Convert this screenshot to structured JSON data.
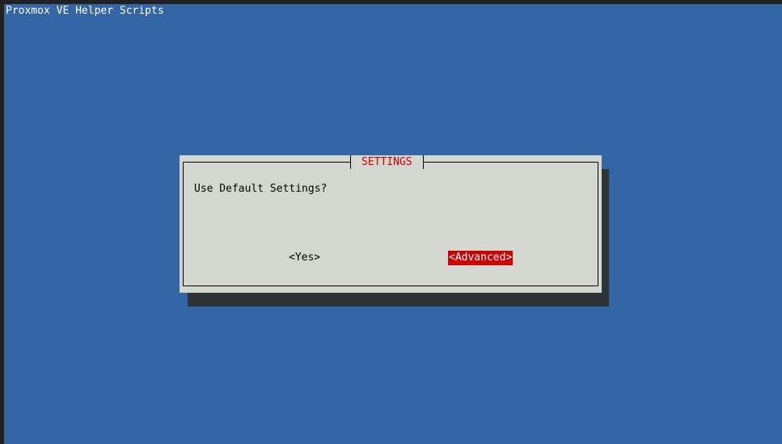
{
  "screen": {
    "backtitle": "Proxmox VE Helper Scripts"
  },
  "dialog": {
    "title": "SETTINGS",
    "message": "Use Default Settings?",
    "buttons": {
      "yes_label": "<Yes>",
      "advanced_label": "<Advanced>",
      "selected": "<Advanced>"
    }
  },
  "colors": {
    "background": "#3465a4",
    "dialog": "#d3d7cf",
    "shadow": "#2e3436",
    "title_text": "#cc0000",
    "selected_button_bg": "#cc0000",
    "selected_button_text": "#ffffff"
  }
}
